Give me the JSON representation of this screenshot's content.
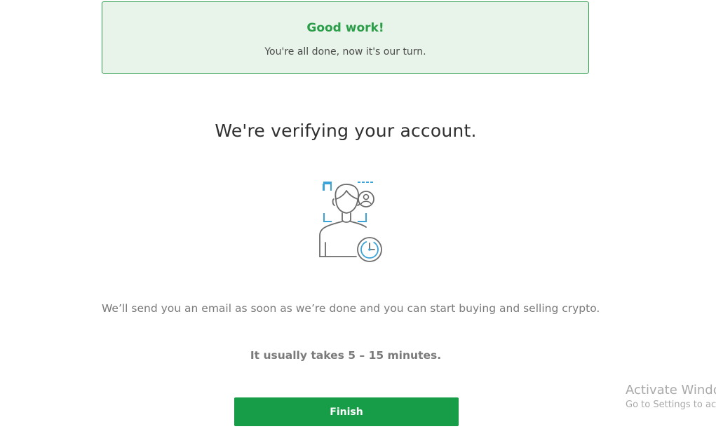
{
  "banner": {
    "title": "Good work!",
    "subtitle": "You're all done, now it's our turn."
  },
  "main": {
    "heading": "We're verifying your account.",
    "illustration_icon": "face-verification-clock-icon",
    "message": "We’ll send you an email as soon as we’re done and you can start buying and selling crypto.",
    "duration": "It usually takes 5 – 15 minutes.",
    "finish_label": "Finish"
  },
  "watermark": {
    "title": "Activate Windows",
    "subtitle": "Go to Settings to activate Windows."
  },
  "colors": {
    "banner_bg": "#e8f4ea",
    "banner_border": "#2f9e4f",
    "success_green": "#2a9d48",
    "button_green": "#179c47",
    "icon_blue": "#3aa3d8",
    "icon_gray": "#6b6b6b"
  }
}
